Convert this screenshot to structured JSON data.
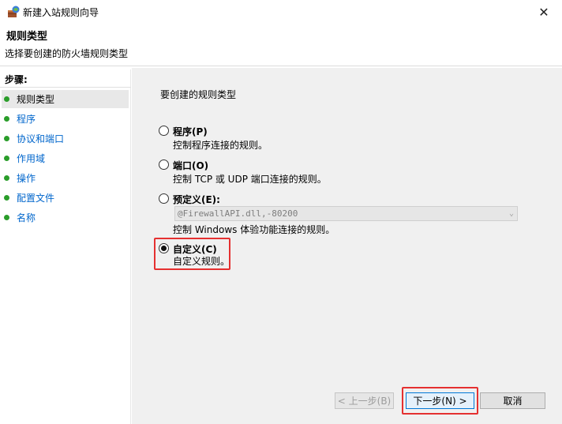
{
  "window": {
    "title": "新建入站规则向导",
    "close_glyph": "✕"
  },
  "header": {
    "title": "规则类型",
    "subtitle": "选择要创建的防火墙规则类型"
  },
  "sidebar": {
    "steps_label": "步骤:",
    "items": [
      {
        "label": "规则类型"
      },
      {
        "label": "程序"
      },
      {
        "label": "协议和端口"
      },
      {
        "label": "作用域"
      },
      {
        "label": "操作"
      },
      {
        "label": "配置文件"
      },
      {
        "label": "名称"
      }
    ]
  },
  "main": {
    "prompt": "要创建的规则类型",
    "options": [
      {
        "title": "程序(P)",
        "desc": "控制程序连接的规则。",
        "checked": false
      },
      {
        "title": "端口(O)",
        "desc": "控制 TCP 或 UDP 端口连接的规则。",
        "checked": false
      },
      {
        "title": "预定义(E):",
        "desc": "控制 Windows 体验功能连接的规则。",
        "checked": false
      },
      {
        "title": "自定义(C)",
        "desc": "自定义规则。",
        "checked": true
      }
    ],
    "predefined_select_value": "@FirewallAPI.dll,-80200"
  },
  "buttons": {
    "back": "< 上一步(B)",
    "next": "下一步(N) >",
    "cancel": "取消"
  },
  "colors": {
    "highlight": "#e53030",
    "step_dot": "#2a9d2a",
    "link": "#0066cc"
  }
}
